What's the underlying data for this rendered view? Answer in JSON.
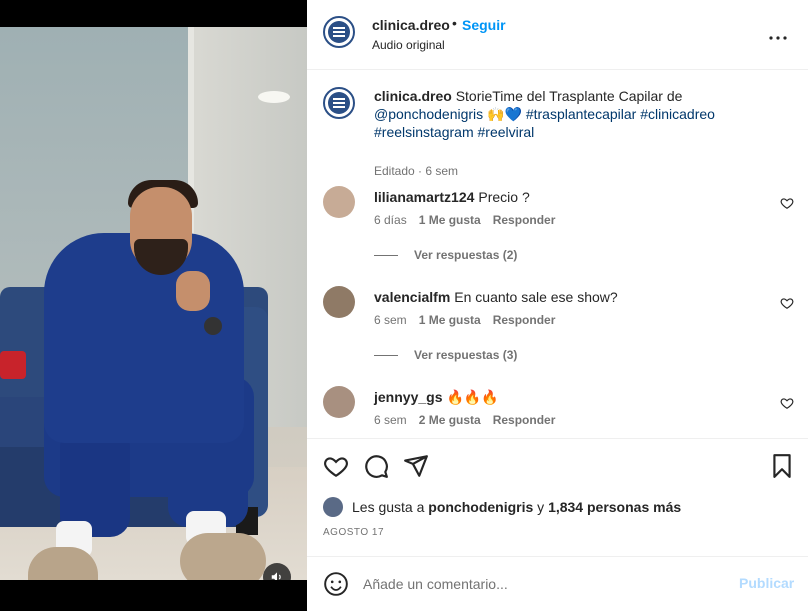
{
  "post": {
    "username": "clinica.dreo",
    "dot": "•",
    "follow_label": "Seguir",
    "audio": "Audio original",
    "more": "•••"
  },
  "caption": {
    "username": "clinica.dreo",
    "text_1": "StorieTime del Trasplante Capilar de",
    "mention": "@ponchodenigris",
    "emojis": "🙌💙",
    "tags_1": "#trasplantecapilar #clinicadreo",
    "tags_2": "#reelsinstagram #reelviral",
    "meta": "Editado · 6 sem"
  },
  "comments": [
    {
      "username": "lilianamartz124",
      "text": "Precio ?",
      "time": "6 días",
      "likes": "1 Me gusta",
      "reply": "Responder",
      "replies_label": "Ver respuestas (2)"
    },
    {
      "username": "valencialfm",
      "text": "En cuanto sale ese show?",
      "time": "6 sem",
      "likes": "1 Me gusta",
      "reply": "Responder",
      "replies_label": "Ver respuestas (3)"
    },
    {
      "username": "jennyy_gs",
      "text": "🔥🔥🔥",
      "time": "6 sem",
      "likes": "2 Me gusta",
      "reply": "Responder"
    }
  ],
  "likes": {
    "prefix": "Les gusta a",
    "user": "ponchodenigris",
    "conj": "y",
    "others": "1,834 personas más"
  },
  "date": "AGOSTO 17",
  "add_comment": {
    "placeholder": "Añade un comentario...",
    "publish": "Publicar"
  },
  "colors": {
    "follow": "#0095f6",
    "tag": "#00376b",
    "publish_disabled": "#b3dbff",
    "brand_avatar": "#2b4f86"
  }
}
